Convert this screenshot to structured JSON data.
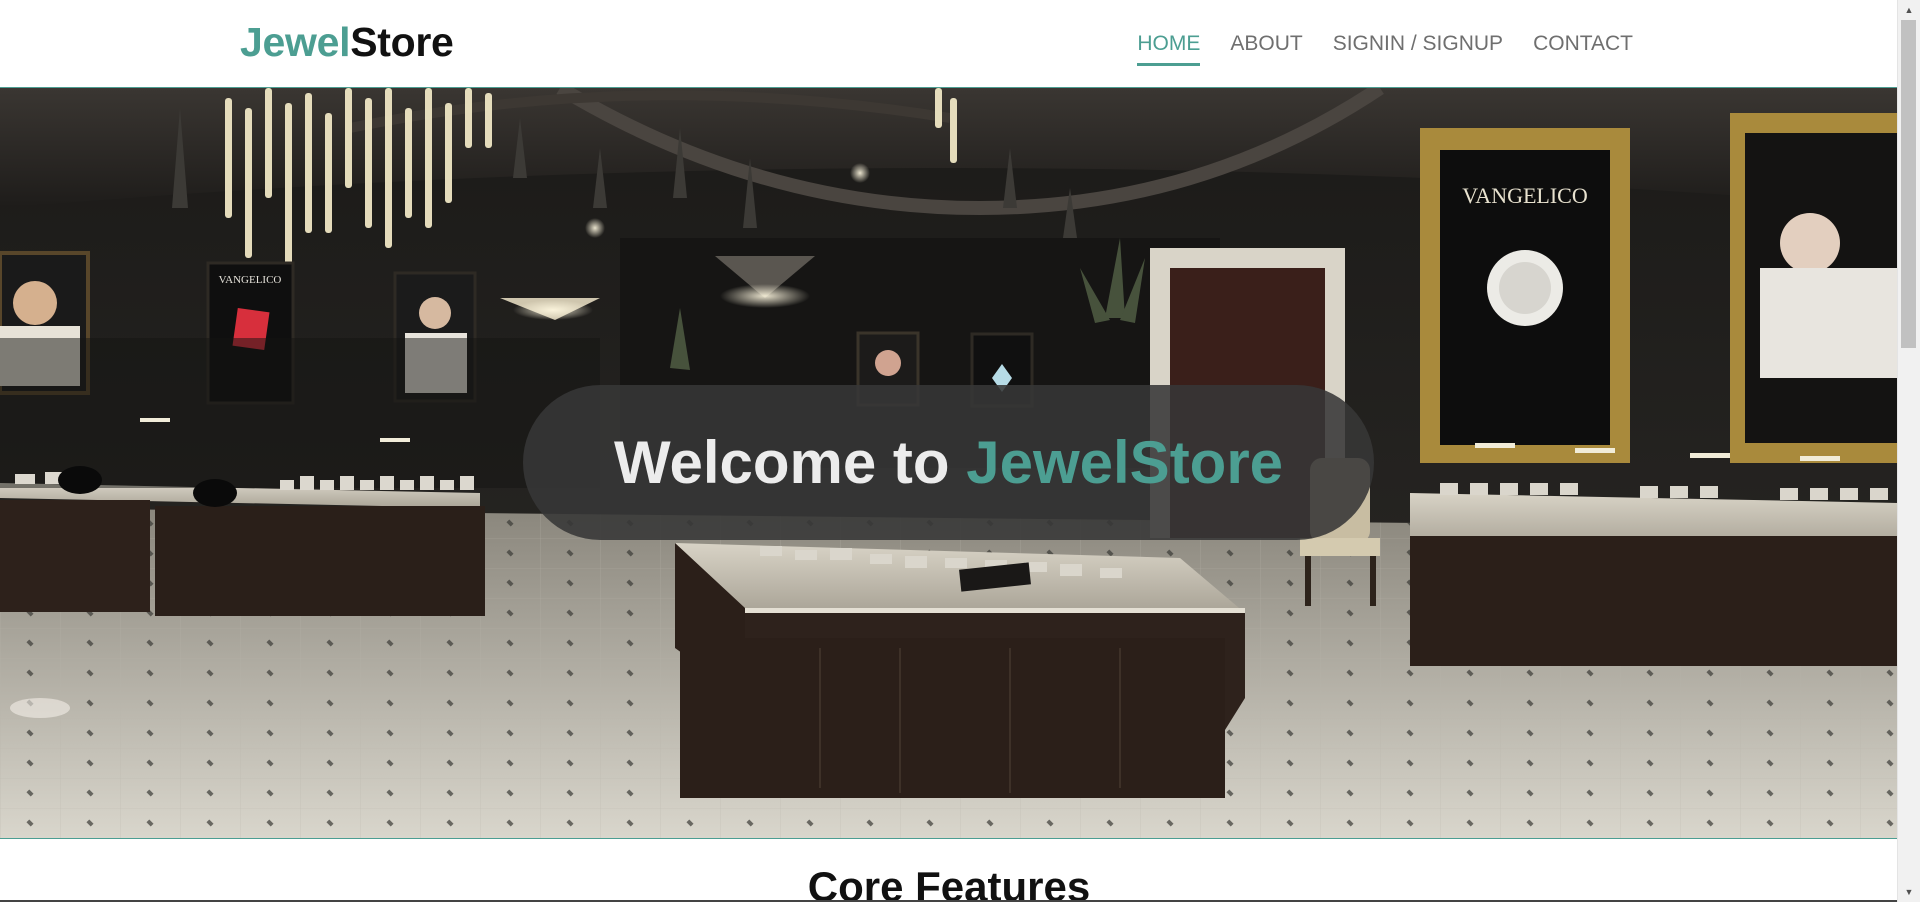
{
  "header": {
    "logo_part1": "Jewel",
    "logo_part2": "Store",
    "nav": [
      {
        "label": "HOME",
        "active": true
      },
      {
        "label": "ABOUT",
        "active": false
      },
      {
        "label": "SIGNIN / SIGNUP",
        "active": false
      },
      {
        "label": "CONTACT",
        "active": false
      }
    ]
  },
  "hero": {
    "welcome_prefix": "Welcome to ",
    "welcome_brand": "JewelStore",
    "image_alt": "Jewelry store interior",
    "sign_text": "VANGELICO"
  },
  "features": {
    "title": "Core Features"
  },
  "colors": {
    "accent": "#4c9e92",
    "text_dark": "#111111",
    "nav_text": "#6f6f6f"
  }
}
